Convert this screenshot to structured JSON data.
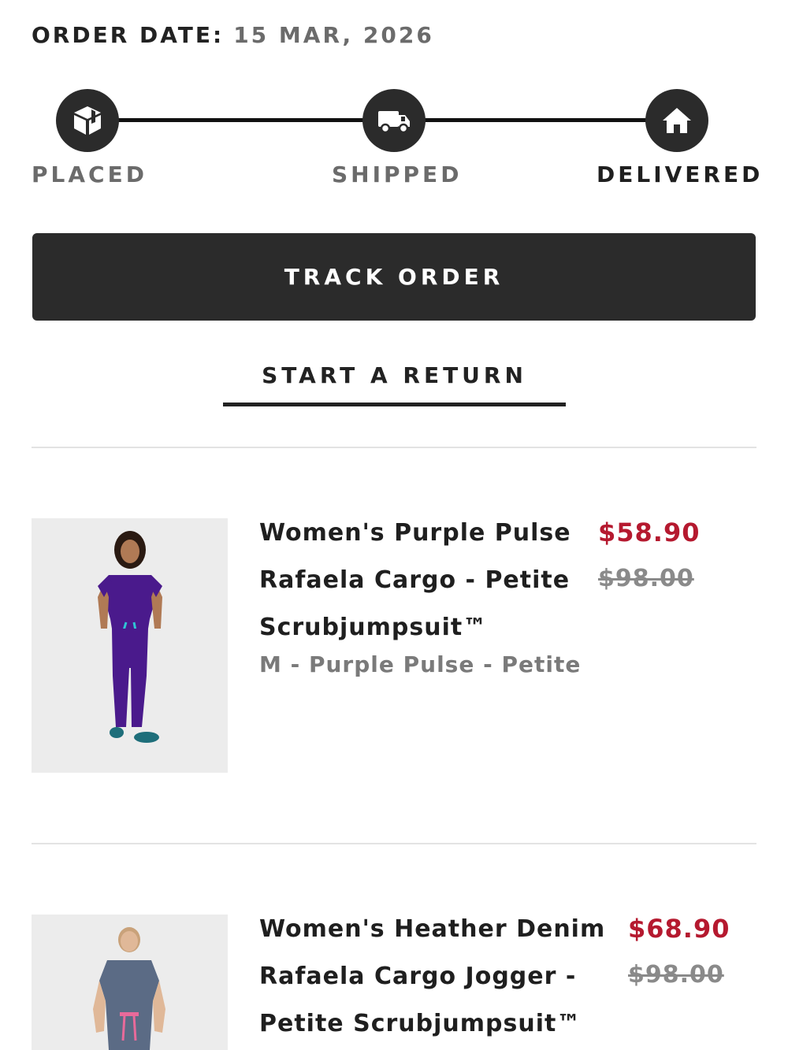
{
  "order": {
    "date_label": "ORDER DATE:",
    "date_value": "15 MAR, 2026"
  },
  "tracker": {
    "steps": [
      {
        "label": "PLACED",
        "icon": "package-icon",
        "active": false
      },
      {
        "label": "SHIPPED",
        "icon": "truck-icon",
        "active": false
      },
      {
        "label": "DELIVERED",
        "icon": "home-icon",
        "active": true
      }
    ]
  },
  "actions": {
    "track_label": "TRACK ORDER",
    "return_label": "START A RETURN"
  },
  "items": [
    {
      "name": "Women's Purple Pulse Rafaela Cargo - Petite Scrubjumpsuit™",
      "name_lines": [
        "Women's Purple Pulse",
        "Rafaela Cargo - Petite",
        "Scrubjumpsuit™"
      ],
      "variant": "M - Purple Pulse - Petite",
      "sale_price": "$58.90",
      "original_price": "$98.00",
      "image_alt": "woman-in-purple-scrubjumpsuit"
    },
    {
      "name": "Women's Heather Denim Rafaela Cargo Jogger - Petite Scrubjumpsuit™",
      "name_lines": [
        "Women's Heather Denim",
        "Rafaela Cargo Jogger -",
        "Petite Scrubjumpsuit™"
      ],
      "variant": "",
      "sale_price": "$68.90",
      "original_price": "$98.00",
      "image_alt": "woman-in-heather-denim-scrubjumpsuit"
    }
  ],
  "colors": {
    "dark": "#2b2b2b",
    "sale_red": "#b5192f",
    "muted": "#7a7a7a",
    "purple_product": "#4a1a8c",
    "denim_product": "#5b6b85"
  }
}
